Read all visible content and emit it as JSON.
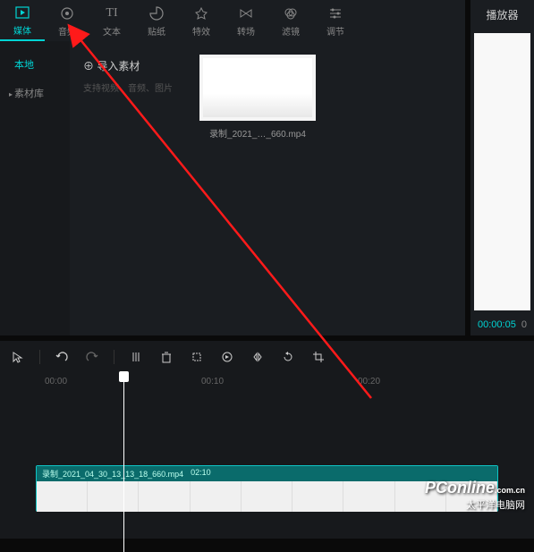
{
  "tabs": [
    {
      "label": "媒体",
      "icon": "▸"
    },
    {
      "label": "音频",
      "icon": "♪"
    },
    {
      "label": "文本",
      "icon": "TI"
    },
    {
      "label": "贴纸",
      "icon": "◔"
    },
    {
      "label": "特效",
      "icon": "✦"
    },
    {
      "label": "转场",
      "icon": "⋈"
    },
    {
      "label": "滤镜",
      "icon": "◎"
    },
    {
      "label": "调节",
      "icon": "⚙"
    }
  ],
  "sidebar": {
    "items": [
      {
        "label": "本地",
        "expandable": false
      },
      {
        "label": "素材库",
        "expandable": true
      }
    ]
  },
  "import": {
    "label": "导入素材",
    "hint": "支持视频、音频、图片"
  },
  "media": {
    "items": [
      {
        "name": "录制_2021_…_660.mp4"
      }
    ]
  },
  "player": {
    "title": "播放器",
    "current_time": "00:00:05",
    "total_time": "0"
  },
  "ruler": {
    "ticks": [
      "00:00",
      "00:10",
      "00:20"
    ]
  },
  "clip": {
    "name": "录制_2021_04_30_13_13_18_660.mp4",
    "duration": "02:10"
  },
  "watermark": {
    "brand": "PConline",
    "suffix": ".com.cn",
    "cn": "太平洋电脑网"
  }
}
